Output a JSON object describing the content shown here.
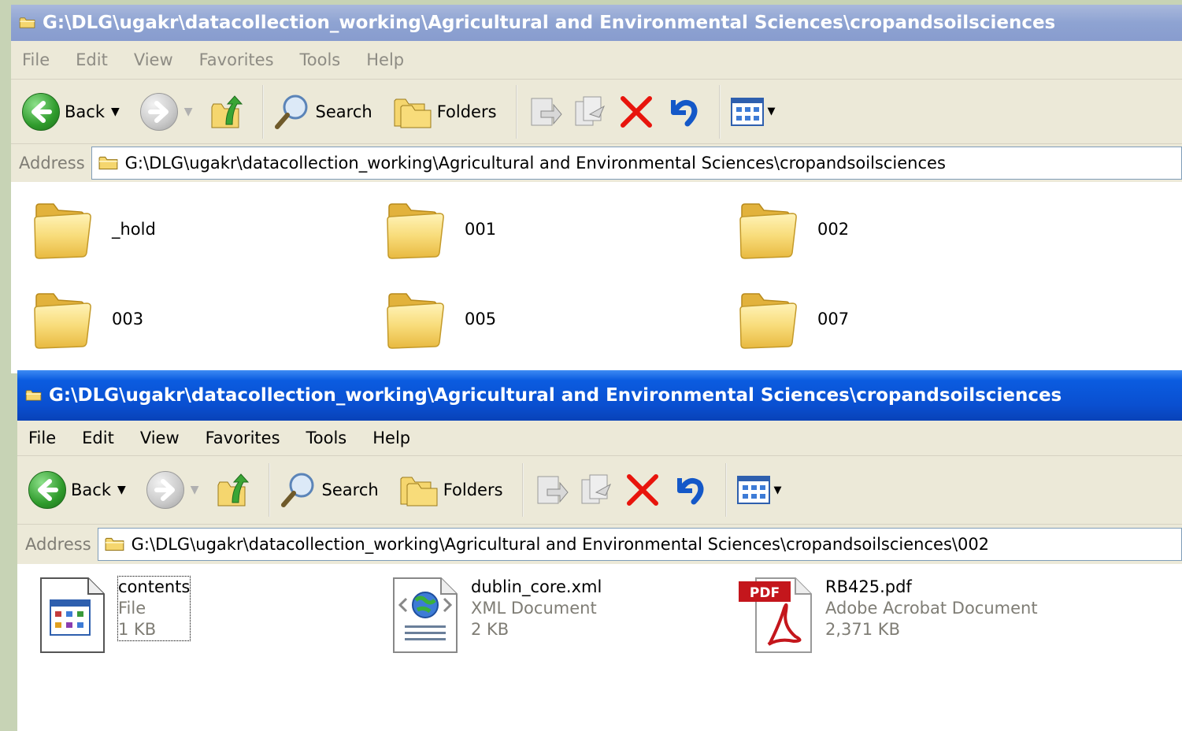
{
  "window_back": {
    "title": "G:\\DLG\\ugakr\\datacollection_working\\Agricultural and Environmental Sciences\\cropandsoilsciences",
    "menu": [
      "File",
      "Edit",
      "View",
      "Favorites",
      "Tools",
      "Help"
    ],
    "toolbar": {
      "back": "Back",
      "search": "Search",
      "folders": "Folders"
    },
    "address_label": "Address",
    "address": "G:\\DLG\\ugakr\\datacollection_working\\Agricultural and Environmental Sciences\\cropandsoilsciences",
    "folders": [
      "_hold",
      "001",
      "002",
      "003",
      "005",
      "007"
    ]
  },
  "window_front": {
    "title": "G:\\DLG\\ugakr\\datacollection_working\\Agricultural and Environmental Sciences\\cropandsoilsciences",
    "menu": [
      "File",
      "Edit",
      "View",
      "Favorites",
      "Tools",
      "Help"
    ],
    "toolbar": {
      "back": "Back",
      "search": "Search",
      "folders": "Folders"
    },
    "address_label": "Address",
    "address": "G:\\DLG\\ugakr\\datacollection_working\\Agricultural and Environmental Sciences\\cropandsoilsciences\\002",
    "files": [
      {
        "name": "contents",
        "type": "File",
        "size": "1 KB",
        "icon": "application-file-icon"
      },
      {
        "name": "dublin_core.xml",
        "type": "XML Document",
        "size": "2 KB",
        "icon": "xml-document-icon"
      },
      {
        "name": "RB425.pdf",
        "type": "Adobe Acrobat Document",
        "size": "2,371 KB",
        "icon": "pdf-document-icon",
        "badge": "PDF"
      }
    ]
  },
  "colors": {
    "titlebar_active": "#0a4fd0",
    "titlebar_inactive": "#8ea3d2",
    "chrome": "#ece9d8",
    "folder": "#f6d46a",
    "delete_red": "#e8140c",
    "pdf_red": "#c4161c"
  }
}
